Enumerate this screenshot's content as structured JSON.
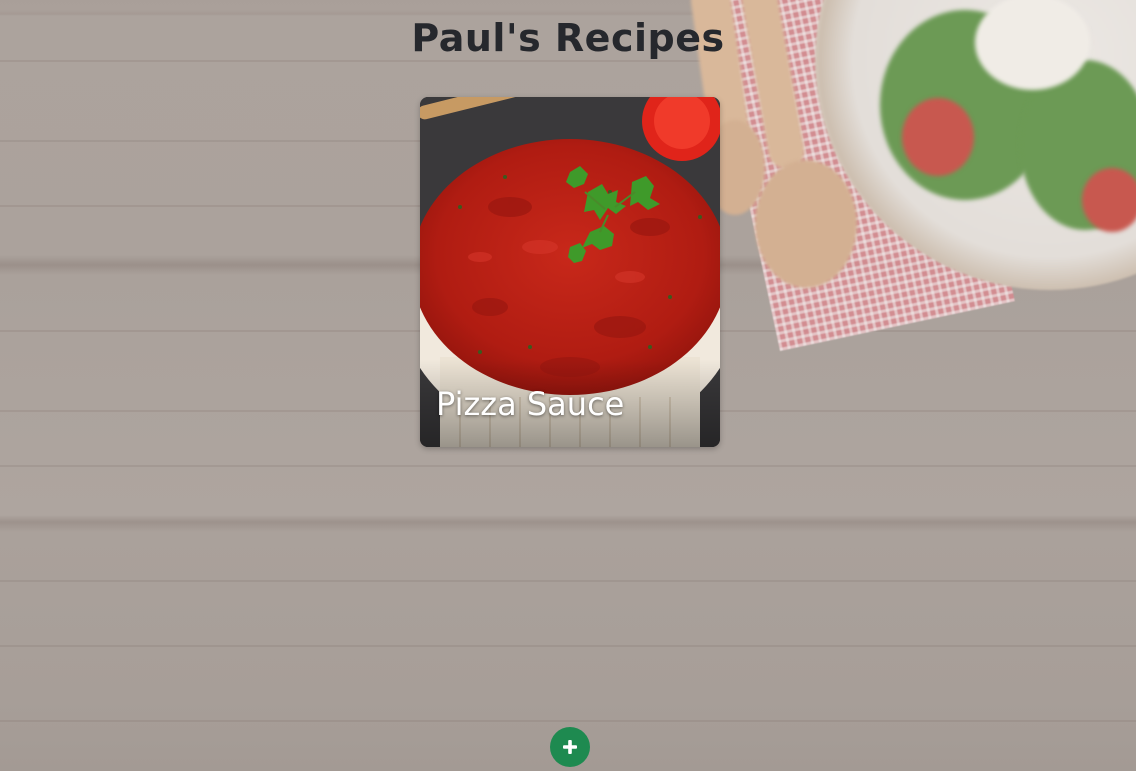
{
  "header": {
    "title": "Paul's Recipes"
  },
  "recipes": [
    {
      "name": "Pizza Sauce",
      "image": "tomato-sauce-bowl-with-parsley"
    }
  ],
  "add_button": {
    "icon": "plus-icon",
    "color": "#1e8a50"
  },
  "theme": {
    "title_color": "#26282d",
    "card_text_color": "#ffffff"
  }
}
